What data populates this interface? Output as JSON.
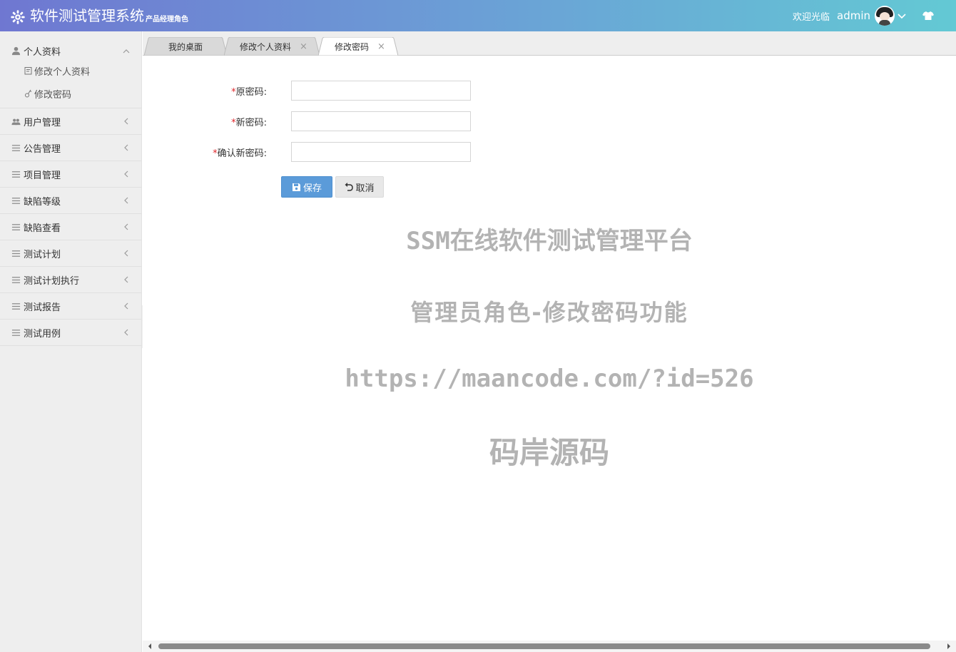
{
  "header": {
    "title": "软件测试管理系统",
    "subtitle": "产品经理角色",
    "welcome": "欢迎光临",
    "username": "admin",
    "icons": [
      "gear-icon",
      "avatar",
      "chevron-down-icon",
      "shirt-icon"
    ]
  },
  "sidebar": {
    "items": [
      {
        "label": "个人资料",
        "icon": "user-icon",
        "open": true,
        "children": [
          {
            "label": "修改个人资料",
            "icon": "edit-icon"
          },
          {
            "label": "修改密码",
            "icon": "key-icon"
          }
        ]
      },
      {
        "label": "用户管理",
        "icon": "users-icon"
      },
      {
        "label": "公告管理",
        "icon": "list-icon"
      },
      {
        "label": "项目管理",
        "icon": "list-icon"
      },
      {
        "label": "缺陷等级",
        "icon": "list-icon"
      },
      {
        "label": "缺陷查看",
        "icon": "list-icon"
      },
      {
        "label": "测试计划",
        "icon": "list-icon"
      },
      {
        "label": "测试计划执行",
        "icon": "list-icon"
      },
      {
        "label": "测试报告",
        "icon": "list-icon"
      },
      {
        "label": "测试用例",
        "icon": "list-icon"
      }
    ]
  },
  "tabs": [
    {
      "label": "我的桌面",
      "closable": false,
      "active": false
    },
    {
      "label": "修改个人资料",
      "closable": true,
      "active": false
    },
    {
      "label": "修改密码",
      "closable": true,
      "active": true
    }
  ],
  "form": {
    "required_mark": "*",
    "old_password_label": "原密码:",
    "new_password_label": "新密码:",
    "confirm_password_label": "确认新密码:",
    "old_password_value": "",
    "new_password_value": "",
    "confirm_password_value": "",
    "save_label": "保存",
    "cancel_label": "取消"
  },
  "watermark": {
    "line1": "SSM在线软件测试管理平台",
    "line2": "管理员角色-修改密码功能",
    "line3": "https://maancode.com/?id=526",
    "line4": "码岸源码"
  },
  "colors": {
    "header_start": "#6f77d1",
    "header_end": "#63c9d4",
    "save_button": "#5b9bd9",
    "required": "#e0262b",
    "watermark": "#b3b3b3"
  }
}
